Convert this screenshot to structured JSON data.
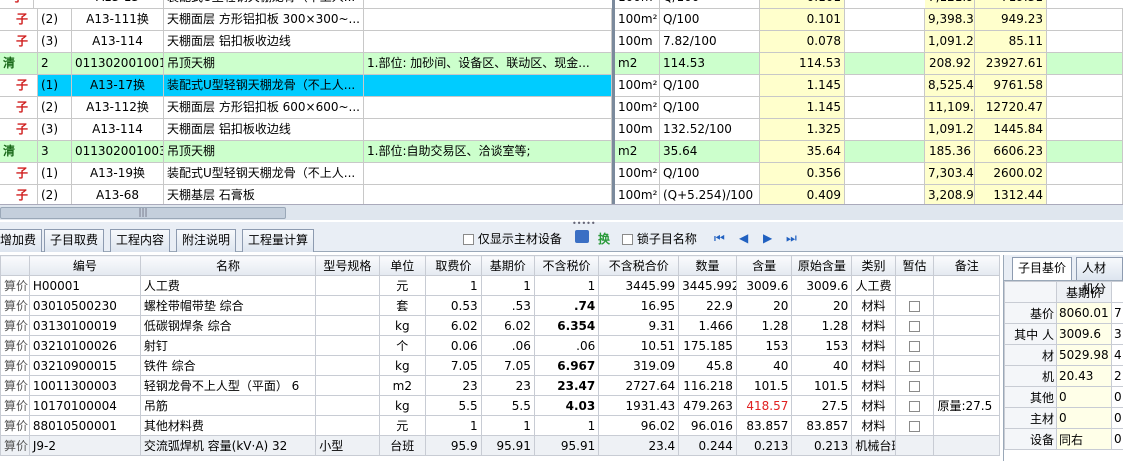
{
  "top_rows": [
    {
      "kind": "sub",
      "tree": "子",
      "seq": "(2)",
      "code": "A13-111换",
      "name": "天棚面层 方形铝扣板 300×300~...",
      "feature": "",
      "unit": "100m²",
      "qty_expr": "Q/100",
      "qty": "0.101",
      "price": "9,398.30",
      "total": "949.23"
    },
    {
      "kind": "sub",
      "tree": "子",
      "seq": "(3)",
      "code": "A13-114",
      "name": "天棚面层 铝扣板收边线",
      "feature": "",
      "unit": "100m",
      "qty_expr": "7.82/100",
      "qty": "0.078",
      "price": "1,091.20",
      "total": "85.11"
    },
    {
      "kind": "main",
      "tree": "清",
      "seq": "2",
      "code": "011302001001",
      "name": "吊顶天棚",
      "feature": "1.部位: 加砂间、设备区、联动区、现金...",
      "unit": "m2",
      "qty_expr": "114.53",
      "qty": "114.53",
      "price": "208.92",
      "total": "23927.61"
    },
    {
      "kind": "selected",
      "tree": "子",
      "seq": "(1)",
      "code": "A13-17换",
      "name": "装配式U型轻钢天棚龙骨（不上人...",
      "feature": "",
      "unit": "100m²",
      "qty_expr": "Q/100",
      "qty": "1.145",
      "price": "8,525.40",
      "total": "9761.58"
    },
    {
      "kind": "sub",
      "tree": "子",
      "seq": "(2)",
      "code": "A13-112换",
      "name": "天棚面层 方形铝扣板 600×600~...",
      "feature": "",
      "unit": "100m²",
      "qty_expr": "Q/100",
      "qty": "1.145",
      "price": "11,109.58",
      "total": "12720.47"
    },
    {
      "kind": "sub",
      "tree": "子",
      "seq": "(3)",
      "code": "A13-114",
      "name": "天棚面层 铝扣板收边线",
      "feature": "",
      "unit": "100m",
      "qty_expr": "132.52/100",
      "qty": "1.325",
      "price": "1,091.20",
      "total": "1445.84"
    },
    {
      "kind": "main",
      "tree": "清",
      "seq": "3",
      "code": "011302001003",
      "name": "吊顶天棚",
      "feature": "1.部位:自助交易区、洽谈室等;",
      "unit": "m2",
      "qty_expr": "35.64",
      "qty": "35.64",
      "price": "185.36",
      "total": "6606.23"
    },
    {
      "kind": "sub",
      "tree": "子",
      "seq": "(1)",
      "code": "A13-19换",
      "name": "装配式U型轻钢天棚龙骨（不上人...",
      "feature": "",
      "unit": "100m²",
      "qty_expr": "Q/100",
      "qty": "0.356",
      "price": "7,303.43",
      "total": "2600.02"
    },
    {
      "kind": "sub",
      "tree": "子",
      "seq": "(2)",
      "code": "A13-68",
      "name": "天棚基层 石膏板",
      "feature": "",
      "unit": "100m²",
      "qty_expr": "(Q+5.254)/100",
      "qty": "0.409",
      "price": "3,208.91",
      "total": "1312.44"
    }
  ],
  "top_partial": {
    "tree": "子",
    "code": "A13-13",
    "name": "装配式U型轻钢天棚龙骨（不上人...",
    "unit": "100m²",
    "qty_expr": "Q/100",
    "qty": "0.101",
    "price": "7,121.90",
    "total": "719.31"
  },
  "tabs": [
    "增加费",
    "子目取费",
    "工程内容",
    "附注说明",
    "工程量计算"
  ],
  "options": {
    "only_main_material": "仅显示主材设备",
    "swap": "换",
    "lock_name": "锁子目名称"
  },
  "nav_icons": [
    "first-icon",
    "prev-icon",
    "next-icon",
    "last-icon"
  ],
  "bottom_headers": [
    "编号",
    "名称",
    "型号规格",
    "单位",
    "取费价",
    "基期价",
    "不含税价",
    "不含税合价",
    "数量",
    "含量",
    "原始含量",
    "类别",
    "暂估",
    "备注"
  ],
  "bottom_rows": [
    {
      "pre": "算价",
      "code": "H00001",
      "name": "人工费",
      "spec": "",
      "unit": "元",
      "fee": "1",
      "base": "1",
      "notax": "1",
      "notax_total": "3445.99",
      "qty": "3445.992",
      "content": "3009.6",
      "orig": "3009.6",
      "cat": "人工费",
      "est": false,
      "note": ""
    },
    {
      "pre": "算价",
      "code": "03010500230",
      "name": "螺栓带帽带垫 综合",
      "spec": "",
      "unit": "套",
      "fee": "0.53",
      "base": ".53",
      "notax": ".74",
      "notax_total": "16.95",
      "qty": "22.9",
      "content": "20",
      "orig": "20",
      "cat": "材料",
      "est": true,
      "note": ""
    },
    {
      "pre": "算价",
      "code": "03130100019",
      "name": "低碳钢焊条 综合",
      "spec": "",
      "unit": "kg",
      "fee": "6.02",
      "base": "6.02",
      "notax": "6.354",
      "notax_total": "9.31",
      "qty": "1.466",
      "content": "1.28",
      "orig": "1.28",
      "cat": "材料",
      "est": true,
      "note": ""
    },
    {
      "pre": "算价",
      "code": "03210100026",
      "name": "射钉",
      "spec": "",
      "unit": "个",
      "fee": "0.06",
      "base": ".06",
      "notax": ".06",
      "notax_total": "10.51",
      "qty": "175.185",
      "content": "153",
      "orig": "153",
      "cat": "材料",
      "est": true,
      "note": ""
    },
    {
      "pre": "算价",
      "code": "03210900015",
      "name": "铁件 综合",
      "spec": "",
      "unit": "kg",
      "fee": "7.05",
      "base": "7.05",
      "notax": "6.967",
      "notax_total": "319.09",
      "qty": "45.8",
      "content": "40",
      "orig": "40",
      "cat": "材料",
      "est": true,
      "note": ""
    },
    {
      "pre": "算价",
      "code": "10011300003",
      "name": "轻钢龙骨不上人型（平面） 6",
      "spec": "",
      "unit": "m2",
      "fee": "23",
      "base": "23",
      "notax": "23.47",
      "notax_total": "2727.64",
      "qty": "116.218",
      "content": "101.5",
      "orig": "101.5",
      "cat": "材料",
      "est": true,
      "note": ""
    },
    {
      "pre": "算价",
      "code": "10170100004",
      "name": "吊筋",
      "spec": "",
      "unit": "kg",
      "fee": "5.5",
      "base": "5.5",
      "notax": "4.03",
      "notax_total": "1931.43",
      "qty": "479.263",
      "content": "418.57",
      "orig": "27.5",
      "cat": "材料",
      "est": true,
      "note": "原量:27.5"
    },
    {
      "pre": "算价",
      "code": "88010500001",
      "name": "其他材料费",
      "spec": "",
      "unit": "元",
      "fee": "1",
      "base": "1",
      "notax": "1",
      "notax_total": "96.02",
      "qty": "96.016",
      "content": "83.857",
      "orig": "83.857",
      "cat": "材料",
      "est": true,
      "note": ""
    },
    {
      "pre": "算价",
      "code": "J9-2",
      "name": "交流弧焊机 容量(kV·A) 32",
      "spec": "小型",
      "unit": "台班",
      "fee": "95.9",
      "base": "95.91",
      "notax": "95.91",
      "notax_total": "23.4",
      "qty": "0.244",
      "content": "0.213",
      "orig": "0.213",
      "cat": "机械台班",
      "est": false,
      "note": ""
    }
  ],
  "right_panel": {
    "tabs": [
      "子目基价",
      "人材机分"
    ],
    "header": "基期价",
    "rows": [
      {
        "label": "基价",
        "value": "8060.01",
        "extra": "7"
      },
      {
        "label": "其中 人",
        "value": "3009.6",
        "extra": "3"
      },
      {
        "label": "材",
        "value": "5029.98",
        "extra": "4"
      },
      {
        "label": "机",
        "value": "20.43",
        "extra": "2"
      },
      {
        "label": "其他",
        "value": "0",
        "extra": "0"
      },
      {
        "label": "主材",
        "value": "0",
        "extra": "0"
      },
      {
        "label": "设备",
        "value": "同右",
        "extra": "0"
      }
    ]
  }
}
